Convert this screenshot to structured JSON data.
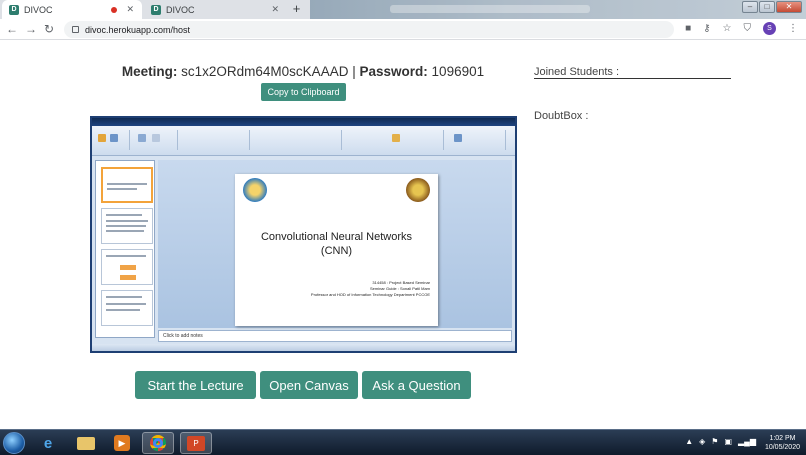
{
  "browser": {
    "tabs": [
      {
        "title": "DIVOC",
        "favicon": "D",
        "recording": true
      },
      {
        "title": "DIVOC",
        "favicon": "D",
        "recording": false
      }
    ],
    "url": "divoc.herokuapp.com/host",
    "profile_initial": "S"
  },
  "meeting": {
    "meeting_label": "Meeting:",
    "meeting_id": "sc1x2ORdm64M0scKAAAD",
    "separator": "|",
    "password_label": "Password:",
    "password": "1096901",
    "copy_button": "Copy to Clipboard"
  },
  "sidebar": {
    "joined_label": "Joined Students :",
    "doubt_label": "DoubtBox :"
  },
  "slide": {
    "title_line1": "Convolutional Neural Networks",
    "title_line2": "(CNN)",
    "subtitle_line1": "314458 : Project Based Seminar",
    "subtitle_line2": "Seminar Guide : Sonali Patil Mam",
    "subtitle_line3": "Professor and HOD of Information Technology Department PCCOE",
    "notes_placeholder": "Click to add notes"
  },
  "actions": {
    "start": "Start the Lecture",
    "canvas": "Open Canvas",
    "question": "Ask a Question"
  },
  "taskbar": {
    "time": "1:02 PM",
    "date": "10/05/2020"
  },
  "colors": {
    "accent": "#3f8f7e",
    "taskbar": "#1a2a40"
  }
}
